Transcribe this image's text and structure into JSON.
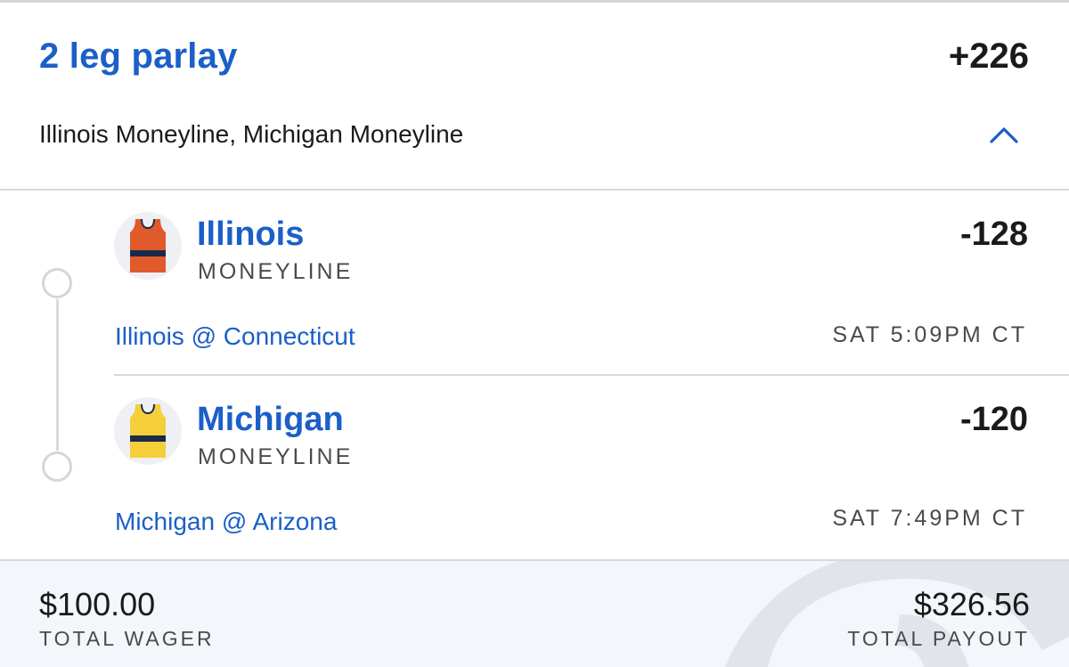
{
  "parlay": {
    "title": "2 leg parlay",
    "odds": "+226",
    "summary": "Illinois Moneyline, Michigan Moneyline"
  },
  "legs": [
    {
      "team": "Illinois",
      "market": "MONEYLINE",
      "odds": "-128",
      "matchup": "Illinois @ Connecticut",
      "time": "SAT 5:09PM CT",
      "jersey_color": "#e15a2c",
      "stripe_color": "#1c2a4a"
    },
    {
      "team": "Michigan",
      "market": "MONEYLINE",
      "odds": "-120",
      "matchup": "Michigan @ Arizona",
      "time": "SAT 7:49PM CT",
      "jersey_color": "#f5cf3a",
      "stripe_color": "#1c2a4a"
    }
  ],
  "footer": {
    "wager_amount": "$100.00",
    "wager_label": "TOTAL WAGER",
    "payout_amount": "$326.56",
    "payout_label": "TOTAL PAYOUT"
  },
  "colors": {
    "accent": "#1b5fc8"
  },
  "icons": {
    "collapse": "chevron-up-icon",
    "leg_jersey": "jersey-icon"
  }
}
